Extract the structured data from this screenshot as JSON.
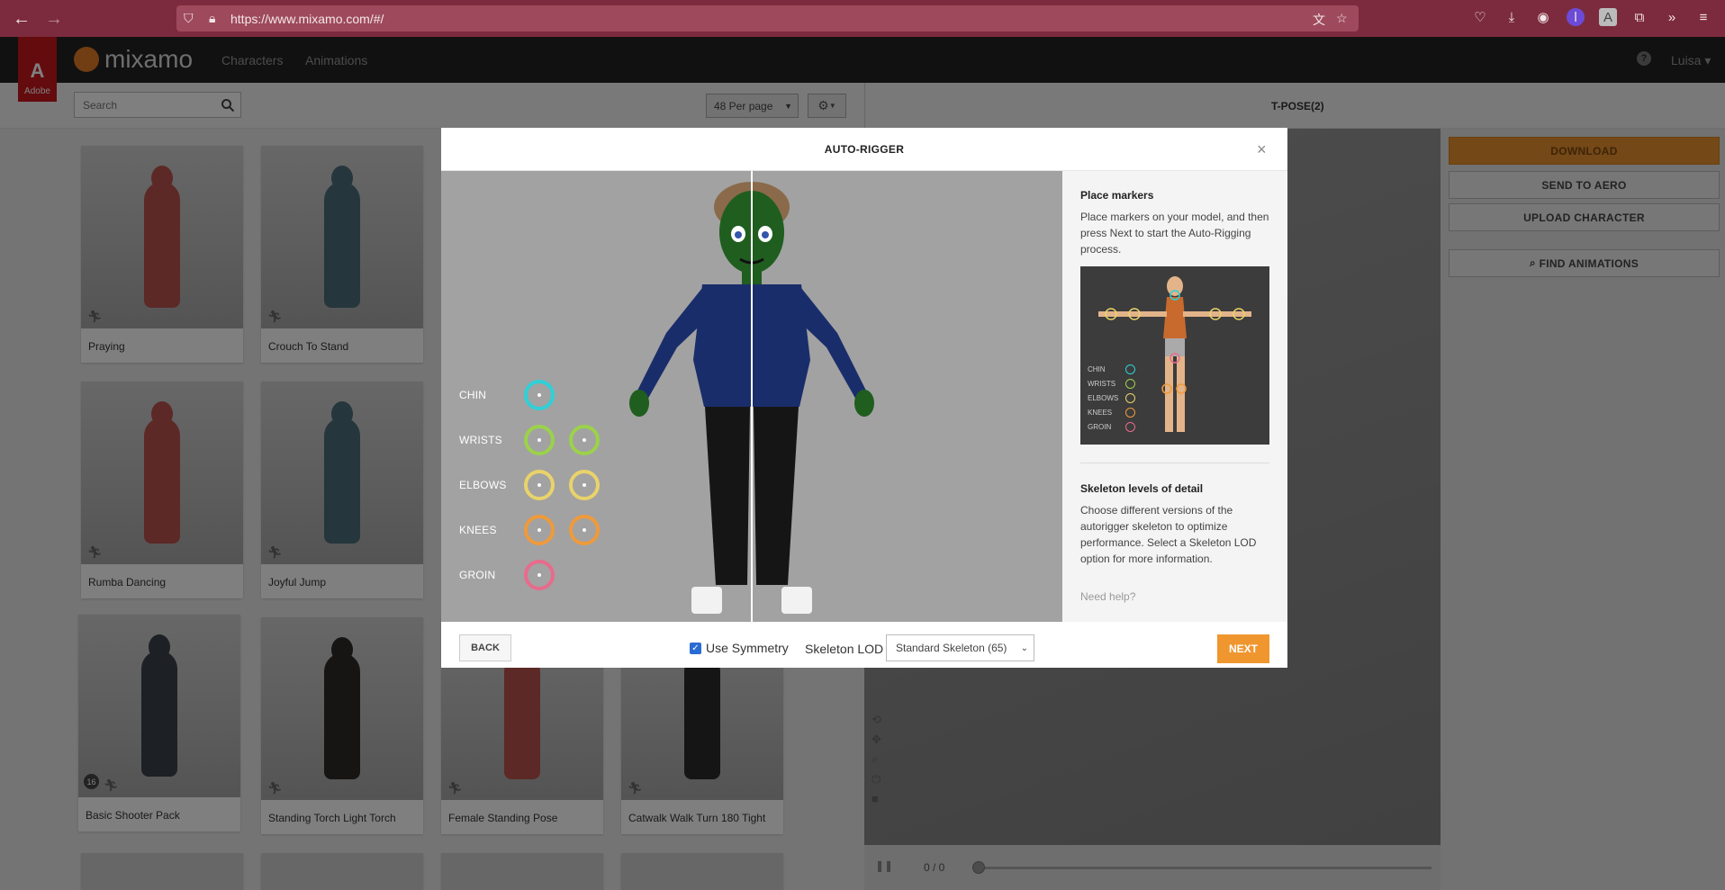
{
  "browser": {
    "url": "https://www.mixamo.com/#/"
  },
  "header": {
    "adobe_label": "Adobe",
    "brand": "mixamo",
    "nav": [
      "Characters",
      "Animations"
    ],
    "help": "?",
    "user": "Luisa"
  },
  "toolbar": {
    "search_placeholder": "Search",
    "per_page": "48 Per page",
    "preview_title": "T-POSE(2)"
  },
  "grid": {
    "cards": [
      {
        "label": "Praying",
        "color": "#b9524c"
      },
      {
        "label": "Crouch To Stand",
        "color": "#4b6c78"
      },
      {
        "label": "Rumba Dancing",
        "color": "#b9524c"
      },
      {
        "label": "Joyful Jump",
        "color": "#4b6c78"
      },
      {
        "label": "Basic Shooter Pack",
        "color": "#3a4048",
        "badge": "16"
      },
      {
        "label": "Standing Torch Light Torch",
        "color": "#2f2a28"
      },
      {
        "label": "Female Standing Pose",
        "color": "#b9524c"
      },
      {
        "label": "Catwalk Walk Turn 180 Tight",
        "color": "#2a2a2a"
      }
    ]
  },
  "side_panel": {
    "download": "DOWNLOAD",
    "send_to_aero": "SEND TO AERO",
    "upload": "UPLOAD CHARACTER",
    "find": "FIND ANIMATIONS"
  },
  "timeline": {
    "count": "0 / 0"
  },
  "modal": {
    "title": "AUTO-RIGGER",
    "markers": [
      {
        "label": "CHIN",
        "color": "#2fd0d8",
        "count": 1
      },
      {
        "label": "WRISTS",
        "color": "#9bd24a",
        "count": 2
      },
      {
        "label": "ELBOWS",
        "color": "#e9d36a",
        "count": 2
      },
      {
        "label": "KNEES",
        "color": "#ef9a3b",
        "count": 2
      },
      {
        "label": "GROIN",
        "color": "#e86b8c",
        "count": 1
      }
    ],
    "info": {
      "place_title": "Place markers",
      "place_text": "Place markers on your model, and then press Next to start the Auto-Rigging process.",
      "lod_title": "Skeleton levels of detail",
      "lod_text": "Choose different versions of the autorigger skeleton to optimize performance. Select a Skeleton LOD option for more information.",
      "need_help": "Need help?",
      "mini_labels": [
        "CHIN",
        "WRISTS",
        "ELBOWS",
        "KNEES",
        "GROIN"
      ]
    },
    "footer": {
      "back": "BACK",
      "symmetry": "Use Symmetry",
      "lod_label": "Skeleton LOD",
      "lod_value": "Standard Skeleton (65)",
      "next": "NEXT"
    }
  }
}
